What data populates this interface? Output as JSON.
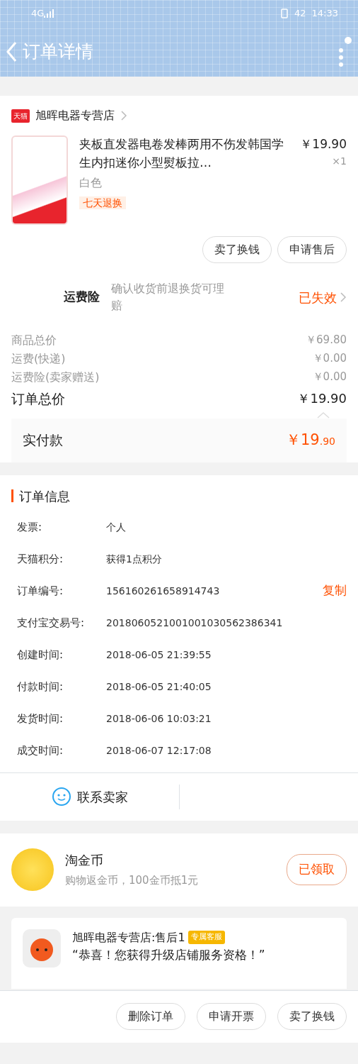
{
  "status_bar": {
    "network": "4G",
    "battery": "42",
    "time": "14:33"
  },
  "header": {
    "title": "订单详情"
  },
  "store": {
    "badge": "天猫",
    "name": "旭晖电器专营店"
  },
  "product": {
    "title": "夹板直发器电卷发棒两用不伤发韩国学生内扣迷你小型熨板拉…",
    "variant": "白色",
    "tag": "七天退换",
    "price": "￥19.90",
    "quantity": "×1"
  },
  "item_actions": [
    "卖了换钱",
    "申请售后"
  ],
  "insurance": {
    "label": "运费险",
    "description": "确认收货前退换货可理赔",
    "status": "已失效"
  },
  "price_rows": [
    {
      "kind": "minor",
      "label": "商品总价",
      "value": "￥69.80"
    },
    {
      "kind": "minor",
      "label": "运费(快递)",
      "value": "￥0.00"
    },
    {
      "kind": "minor",
      "label": "运费险(卖家赠送)",
      "value": "￥0.00"
    },
    {
      "kind": "total",
      "label": "订单总价",
      "value": "￥19.90"
    }
  ],
  "payment": {
    "label": "实付款",
    "amount": "￥19",
    "cents": ".90"
  },
  "order_info": {
    "title": "订单信息",
    "rows": [
      {
        "label": "发票:",
        "value": "个人"
      },
      {
        "label": "天猫积分:",
        "value": "获得1点积分"
      },
      {
        "label": "订单编号:",
        "value": "156160261658914743",
        "action": "复制"
      },
      {
        "label": "支付宝交易号:",
        "value": "2018060521001001030562386341"
      },
      {
        "label": "创建时间:",
        "value": "2018-06-05 21:39:55"
      },
      {
        "label": "付款时间:",
        "value": "2018-06-05 21:40:05"
      },
      {
        "label": "发货时间:",
        "value": "2018-06-06 10:03:21"
      },
      {
        "label": "成交时间:",
        "value": "2018-06-07 12:17:08"
      }
    ]
  },
  "contact": {
    "label": "联系卖家"
  },
  "coins": {
    "title": "淘金币",
    "subtitle": "购物返金币，100金币抵1元",
    "button": "已领取"
  },
  "chat": {
    "sender": "旭晖电器专营店:售后1",
    "tag": "专属客服",
    "message": "“恭喜！您获得升级店铺服务资格！”"
  },
  "bottom_actions": [
    "删除订单",
    "申请开票",
    "卖了换钱"
  ]
}
